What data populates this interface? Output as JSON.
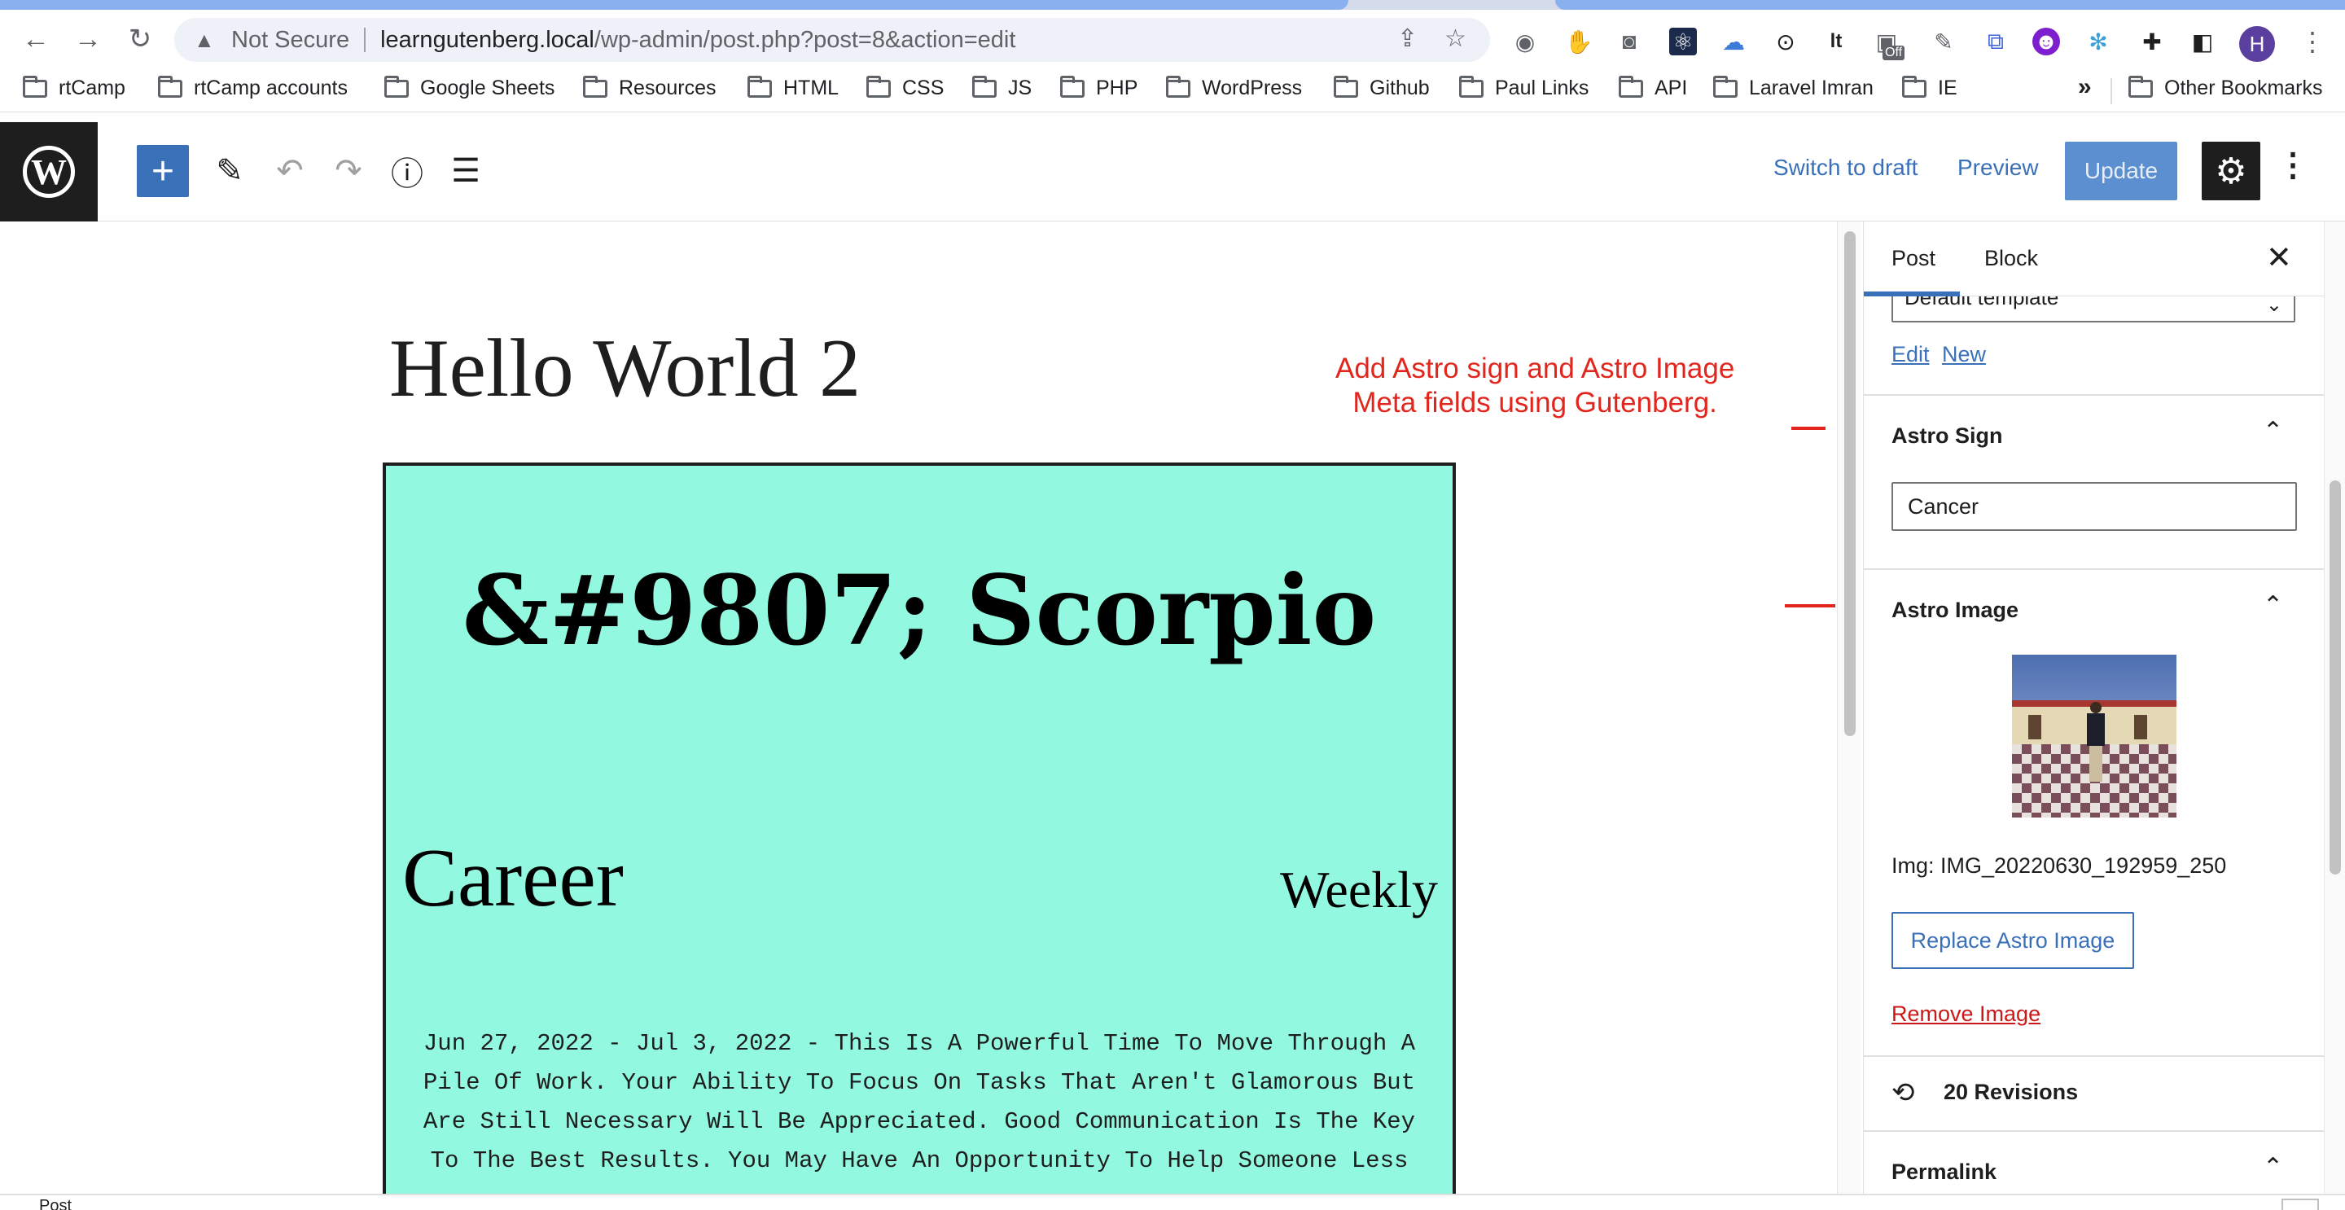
{
  "browser": {
    "omnibox": {
      "security_label": "Not Secure",
      "host": "learngutenberg.local",
      "path": "/wp-admin/post.php?post=8&action=edit"
    },
    "extension_badge": "Off",
    "profile_initial": "H",
    "bookmarks": [
      "rtCamp",
      "rtCamp accounts",
      "Google Sheets",
      "Resources",
      "HTML",
      "CSS",
      "JS",
      "PHP",
      "WordPress",
      "Github",
      "Paul Links",
      "API",
      "Laravel Imran",
      "IE"
    ],
    "bookmarks_overflow": "»",
    "other_bookmarks": "Other Bookmarks"
  },
  "editor_header": {
    "switch_to_draft": "Switch to draft",
    "preview": "Preview",
    "update": "Update"
  },
  "post": {
    "title": "Hello World 2",
    "card": {
      "heading": "&#9807; Scorpio",
      "category": "Career",
      "period": "Weekly",
      "text": "Jun 27, 2022 - Jul 3, 2022 - This Is A Powerful Time To Move Through A Pile Of Work. Your Ability To Focus On Tasks That Aren't Glamorous But Are Still Necessary Will Be Appreciated. Good Communication Is The Key To The Best Results. You May Have An Opportunity To Help Someone Less"
    }
  },
  "annotation": {
    "text": "Add Astro sign and Astro Image\nMeta fields using Gutenberg.",
    "color": "#e2261e"
  },
  "sidebar": {
    "tabs": [
      "Post",
      "Block"
    ],
    "active_tab": "Post",
    "template_value": "Default template",
    "template_links": [
      "Edit",
      "New"
    ],
    "astro_sign": {
      "title": "Astro Sign",
      "value": "Cancer"
    },
    "astro_image": {
      "title": "Astro Image",
      "caption": "Img: IMG_20220630_192959_250",
      "replace_button": "Replace Astro Image",
      "remove_link": "Remove Image"
    },
    "revisions": "20 Revisions",
    "permalink": "Permalink"
  },
  "footer": {
    "breadcrumb": "Post"
  },
  "colors": {
    "accent": "#3a70b8",
    "card_background": "#93f8e0",
    "danger": "#cc1818"
  }
}
